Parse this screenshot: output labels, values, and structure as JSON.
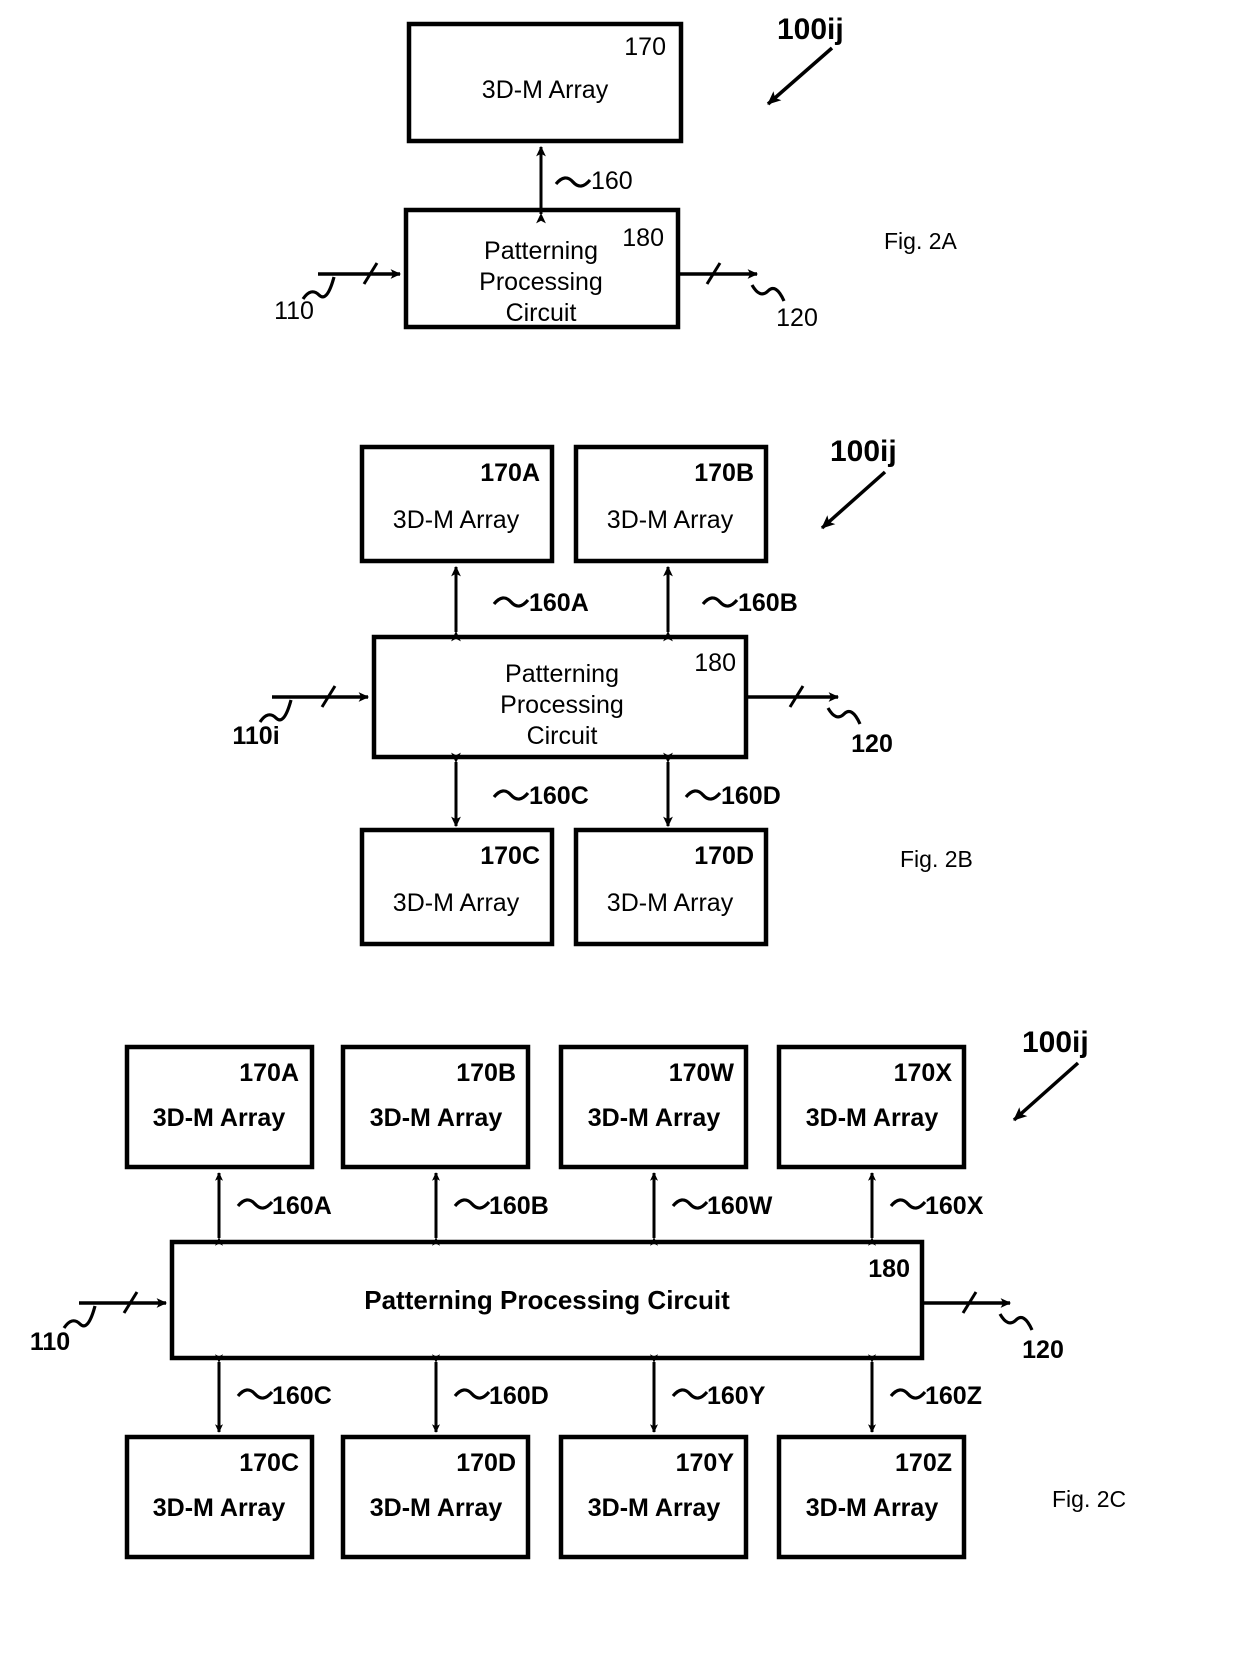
{
  "document": {
    "kind": "patent-figure-sheet",
    "sheet_labels": [
      "Fig. 2A",
      "Fig. 2B",
      "Fig. 2C"
    ]
  },
  "common": {
    "array_label": "3D-M Array",
    "ppc_line1": "Patterning",
    "ppc_line2": "Processing",
    "ppc_line3": "Circuit",
    "ppc_single_line": "Patterning Processing Circuit",
    "ppc_ref": "180",
    "system_ref": "100ij",
    "input_ref": "110",
    "input_ref_indexed": "110i",
    "output_ref": "120"
  },
  "fig2a": {
    "caption": "Fig. 2A",
    "system_ref": "100ij",
    "array": {
      "ref": "170",
      "label": "3D-M Array"
    },
    "ppc": {
      "ref": "180",
      "lines": [
        "Patterning",
        "Processing",
        "Circuit"
      ]
    },
    "bus": {
      "ref": "160"
    },
    "input": {
      "ref": "110"
    },
    "output": {
      "ref": "120"
    }
  },
  "fig2b": {
    "caption": "Fig. 2B",
    "system_ref": "100ij",
    "ppc": {
      "ref": "180",
      "lines": [
        "Patterning",
        "Processing",
        "Circuit"
      ]
    },
    "input": {
      "ref": "110i"
    },
    "output": {
      "ref": "120"
    },
    "arrays_top": [
      {
        "ref": "170A",
        "label": "3D-M Array"
      },
      {
        "ref": "170B",
        "label": "3D-M Array"
      }
    ],
    "arrays_bottom": [
      {
        "ref": "170C",
        "label": "3D-M Array"
      },
      {
        "ref": "170D",
        "label": "3D-M Array"
      }
    ],
    "buses_top": [
      {
        "ref": "160A"
      },
      {
        "ref": "160B"
      }
    ],
    "buses_bottom": [
      {
        "ref": "160C"
      },
      {
        "ref": "160D"
      }
    ]
  },
  "fig2c": {
    "caption": "Fig. 2C",
    "system_ref": "100ij",
    "ppc": {
      "ref": "180",
      "label": "Patterning Processing Circuit"
    },
    "input": {
      "ref": "110"
    },
    "output": {
      "ref": "120"
    },
    "arrays_top": [
      {
        "ref": "170A",
        "label": "3D-M Array"
      },
      {
        "ref": "170B",
        "label": "3D-M Array"
      },
      {
        "ref": "170W",
        "label": "3D-M Array"
      },
      {
        "ref": "170X",
        "label": "3D-M Array"
      }
    ],
    "arrays_bottom": [
      {
        "ref": "170C",
        "label": "3D-M Array"
      },
      {
        "ref": "170D",
        "label": "3D-M Array"
      },
      {
        "ref": "170Y",
        "label": "3D-M Array"
      },
      {
        "ref": "170Z",
        "label": "3D-M Array"
      }
    ],
    "buses_top": [
      {
        "ref": "160A"
      },
      {
        "ref": "160B"
      },
      {
        "ref": "160W"
      },
      {
        "ref": "160X"
      }
    ],
    "buses_bottom": [
      {
        "ref": "160C"
      },
      {
        "ref": "160D"
      },
      {
        "ref": "160Y"
      },
      {
        "ref": "160Z"
      }
    ]
  },
  "colors": {
    "ink": "#000000",
    "paper": "#ffffff"
  }
}
